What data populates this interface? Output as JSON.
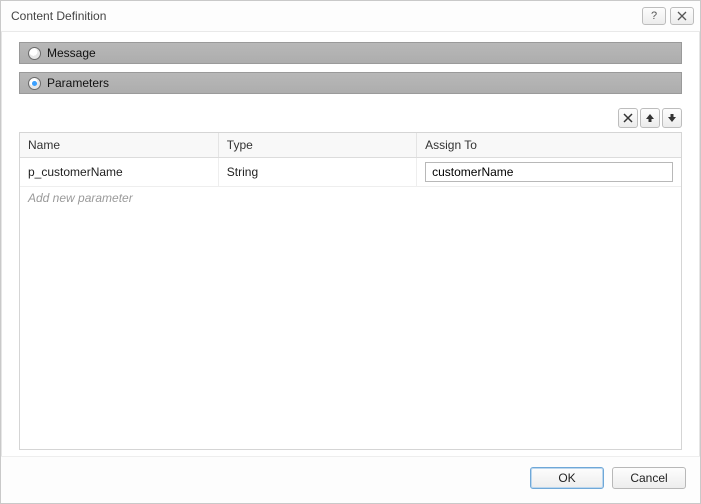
{
  "dialog": {
    "title": "Content Definition"
  },
  "options": {
    "message": {
      "label": "Message",
      "selected": false
    },
    "parameters": {
      "label": "Parameters",
      "selected": true
    }
  },
  "table": {
    "columns": {
      "name": "Name",
      "type": "Type",
      "assign": "Assign To"
    },
    "rows": [
      {
        "name": "p_customerName",
        "type": "String",
        "assign": "customerName"
      }
    ],
    "add_placeholder": "Add new parameter"
  },
  "buttons": {
    "ok": "OK",
    "cancel": "Cancel"
  }
}
